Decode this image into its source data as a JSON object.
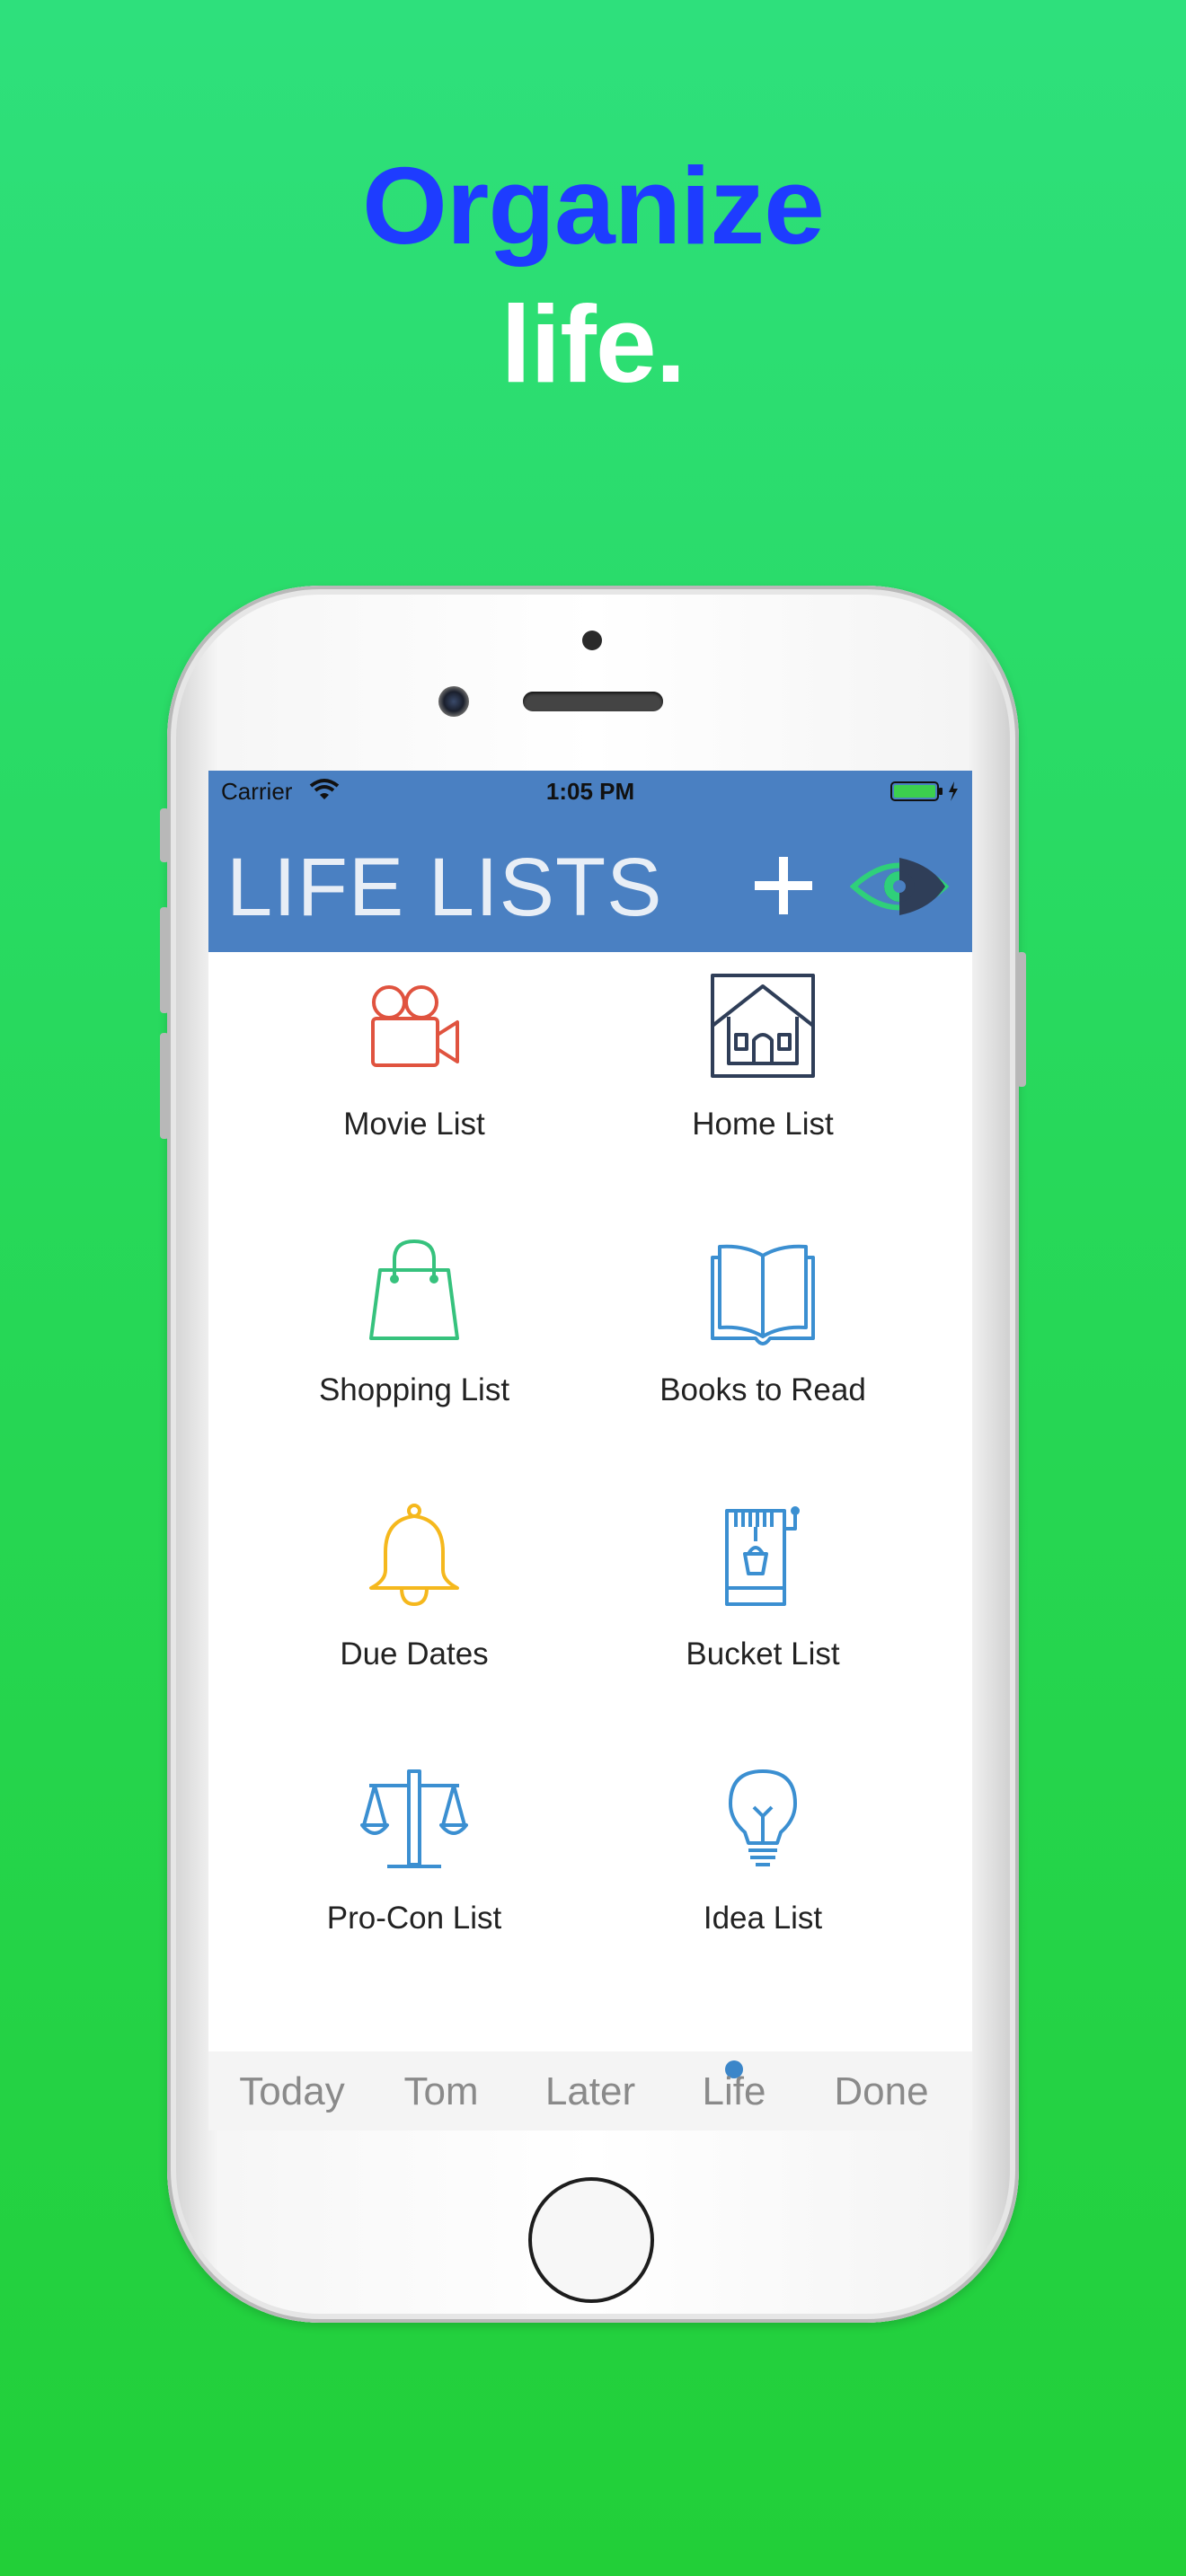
{
  "headline": {
    "line1": "Organize",
    "line2": "life."
  },
  "status_bar": {
    "carrier": "Carrier",
    "time": "1:05 PM"
  },
  "header": {
    "title": "LIFE LISTS",
    "add_icon": "plus-icon",
    "view_icon": "eye-icon"
  },
  "lists": [
    {
      "label": "Movie List",
      "icon": "movie-camera-icon",
      "color": "#e0533f"
    },
    {
      "label": "Home List",
      "icon": "house-icon",
      "color": "#2f3e58"
    },
    {
      "label": "Shopping List",
      "icon": "shopping-bag-icon",
      "color": "#36c27d"
    },
    {
      "label": "Books to Read",
      "icon": "open-book-icon",
      "color": "#3b8fd1"
    },
    {
      "label": "Due Dates",
      "icon": "bell-icon",
      "color": "#f5b81d"
    },
    {
      "label": "Bucket List",
      "icon": "wishing-well-icon",
      "color": "#3b8fd1"
    },
    {
      "label": "Pro-Con List",
      "icon": "balance-scale-icon",
      "color": "#3b8fd1"
    },
    {
      "label": "Idea List",
      "icon": "lightbulb-icon",
      "color": "#3b8fd1"
    }
  ],
  "tabs": [
    {
      "label": "Today"
    },
    {
      "label": "Tom"
    },
    {
      "label": "Later"
    },
    {
      "label": "Life",
      "selected": true
    },
    {
      "label": "Done"
    }
  ],
  "colors": {
    "header": "#4a80c2",
    "headline_blue": "#1e3cff",
    "background": "#27d85a"
  }
}
